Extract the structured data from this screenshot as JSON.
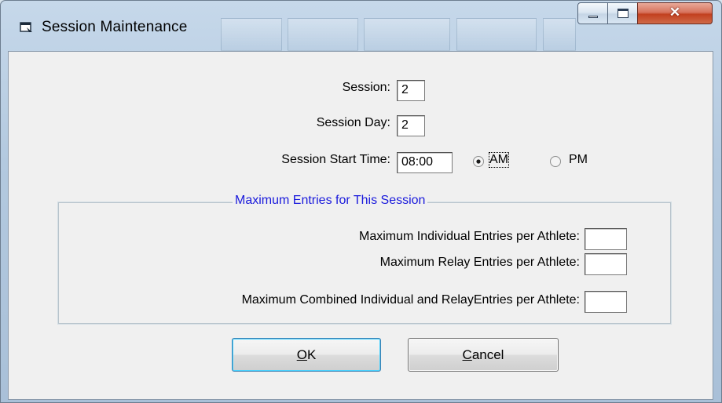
{
  "window": {
    "title": "Session Maintenance"
  },
  "form": {
    "session_label": "Session:",
    "session_value": "2",
    "session_day_label": "Session Day:",
    "session_day_value": "2",
    "start_time_label": "Session Start Time:",
    "start_time_value": "08:00",
    "am_label": "AM",
    "pm_label": "PM",
    "selected_period": "AM"
  },
  "max_entries": {
    "legend": "Maximum Entries for This Session",
    "individual_label": "Maximum Individual Entries per Athlete:",
    "individual_value": "",
    "relay_label": "Maximum Relay Entries per Athlete:",
    "relay_value": "",
    "combined_label": "Maximum  Combined Individual and RelayEntries per Athlete:",
    "combined_value": ""
  },
  "buttons": {
    "ok_mnemonic": "O",
    "ok_rest": "K",
    "cancel_mnemonic": "C",
    "cancel_rest": "ancel"
  },
  "icons": {
    "title": "window-app-icon",
    "minimize": "minimize-icon",
    "maximize": "maximize-icon",
    "close": "close-icon"
  },
  "colors": {
    "group_legend": "#1a1adc",
    "close_button": "#c2401f"
  }
}
